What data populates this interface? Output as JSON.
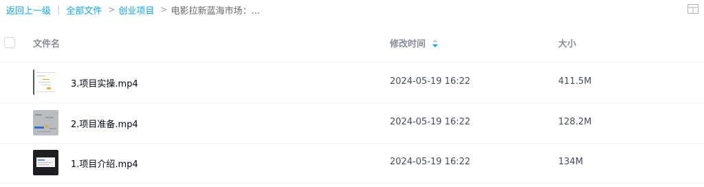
{
  "breadcrumb": {
    "back": "返回上一级",
    "all_files": "全部文件",
    "folder": "创业项目",
    "current": "电影拉新蓝海市场：..."
  },
  "view_toggle_icon": "grid-view-icon",
  "table": {
    "columns": {
      "name": "文件名",
      "modified": "修改时间",
      "size": "大小"
    },
    "sort_icon": "sort-arrow-icon",
    "rows": [
      {
        "name": "3.项目实操.mp4",
        "modified": "2024-05-19 16:22",
        "size": "411.5M",
        "thumb_icon": "video-thumbnail"
      },
      {
        "name": "2.项目准备.mp4",
        "modified": "2024-05-19 16:22",
        "size": "128.2M",
        "thumb_icon": "video-thumbnail"
      },
      {
        "name": "1.项目介绍.mp4",
        "modified": "2024-05-19 16:22",
        "size": "134M",
        "thumb_icon": "video-thumbnail"
      }
    ]
  },
  "colors": {
    "link": "#06a7ff",
    "header_text": "#878c9c",
    "divider": "#f1f2f4"
  }
}
